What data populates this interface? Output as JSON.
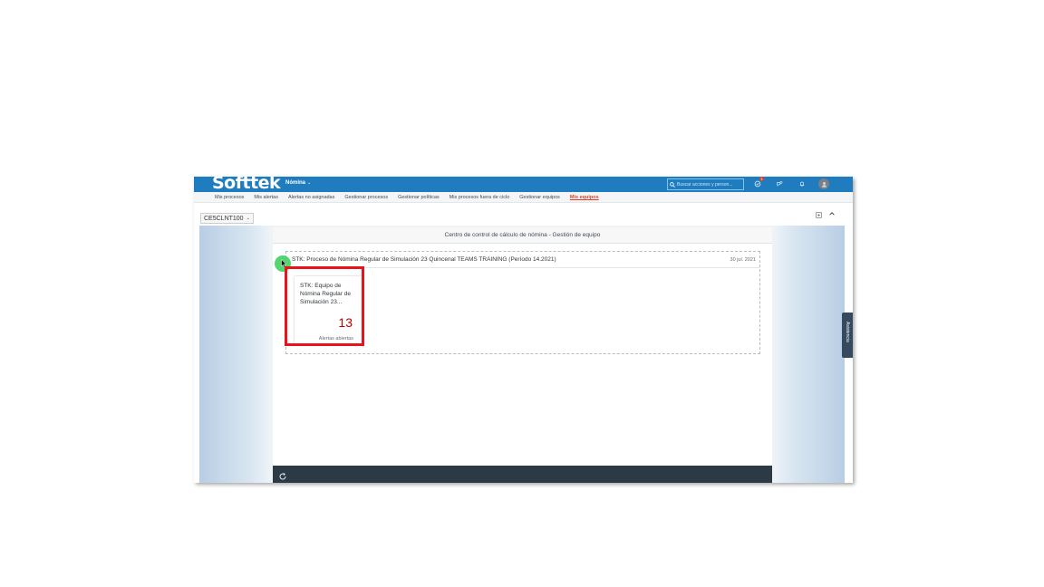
{
  "header": {
    "logo": "Softtek",
    "app_menu": "Nómina",
    "search_placeholder": "Buscar acciones y person...",
    "notification_count": "1",
    "colors": {
      "brand": "#1f7cbf",
      "alert": "#e0432c"
    }
  },
  "nav": {
    "items": [
      {
        "label": "Mis procesos",
        "active": false
      },
      {
        "label": "Mis alertas",
        "active": false
      },
      {
        "label": "Alertas no asignadas",
        "active": false
      },
      {
        "label": "Gestionar procesos",
        "active": false
      },
      {
        "label": "Gestionar políticas",
        "active": false
      },
      {
        "label": "Mis procesos fuera de ciclo",
        "active": false
      },
      {
        "label": "Gestionar equipos",
        "active": false
      },
      {
        "label": "Mis equipos",
        "active": true
      }
    ]
  },
  "subheader": {
    "variant": "CE5CLNT100"
  },
  "panel": {
    "title": "Centro de control de cálculo de nómina - Gestión de equipo",
    "process": {
      "title": "STK: Proceso de Nómina Regular de Simulación 23 Quincenal TEAMS TRAINING (Período 14.2021)",
      "date": "30 jul. 2021"
    },
    "tile": {
      "title": "STK: Equipo de Nómina Regular de Simulación 23...",
      "count": "13",
      "label": "Alertas abiertas"
    }
  },
  "side_tab": {
    "label": "Asistencia"
  }
}
